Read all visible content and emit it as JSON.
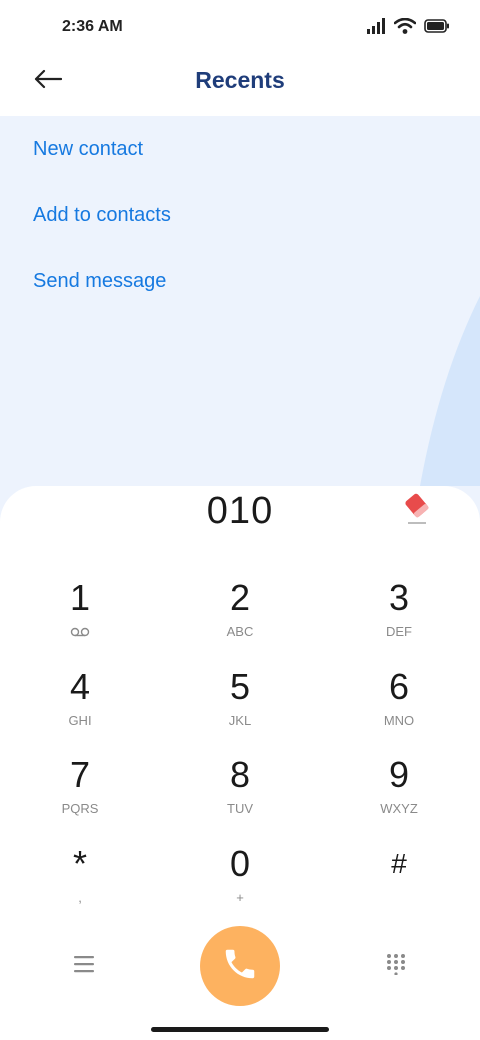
{
  "status_bar": {
    "time": "2:36 AM"
  },
  "header": {
    "title": "Recents"
  },
  "actions": [
    {
      "label": "New contact"
    },
    {
      "label": "Add to contacts"
    },
    {
      "label": "Send message"
    }
  ],
  "dialpad": {
    "number": "010",
    "keys": [
      {
        "digit": "1",
        "letters": ""
      },
      {
        "digit": "2",
        "letters": "ABC"
      },
      {
        "digit": "3",
        "letters": "DEF"
      },
      {
        "digit": "4",
        "letters": "GHI"
      },
      {
        "digit": "5",
        "letters": "JKL"
      },
      {
        "digit": "6",
        "letters": "MNO"
      },
      {
        "digit": "7",
        "letters": "PQRS"
      },
      {
        "digit": "8",
        "letters": "TUV"
      },
      {
        "digit": "9",
        "letters": "WXYZ"
      },
      {
        "digit": "*",
        "letters": ","
      },
      {
        "digit": "0",
        "letters": "+"
      },
      {
        "digit": "#",
        "letters": ""
      }
    ]
  },
  "icons": {
    "signal": "signal-icon",
    "wifi": "wifi-icon",
    "battery": "battery-icon",
    "back": "arrow-left-icon",
    "erase": "eraser-icon",
    "voicemail": "voicemail-icon",
    "menu": "menu-icon",
    "call": "phone-icon",
    "keypad": "keypad-icon"
  },
  "colors": {
    "title": "#1f3d7a",
    "action_link": "#1679e0",
    "panel_bg": "#edf3fd",
    "call_button": "#fdb260",
    "erase_icon": "#e84b4b"
  }
}
